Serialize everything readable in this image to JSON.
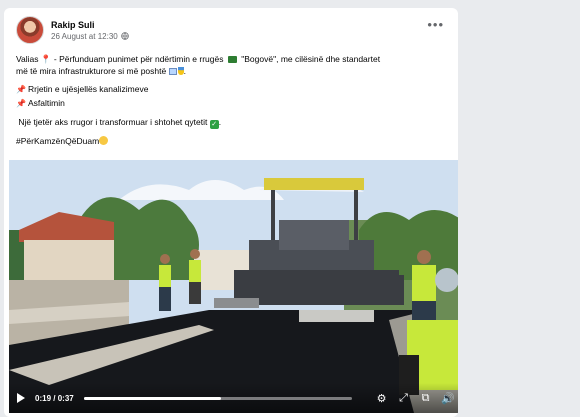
{
  "post": {
    "author": "Rakip Suli",
    "timestamp": "26 August at 12:30",
    "privacy_icon": "globe-icon",
    "more_icon": "more-options-icon",
    "more_glyph": "•••",
    "line1_prefix": "Valias",
    "line1_text": "- Përfunduam punimet për ndërtimin e rrugës",
    "line1_quote": "\"Bogovë\", me cilësinë dhe standartet",
    "line2_text": "më të mira infrastrukturore si më poshtë",
    "bullet1": "Rrjetin e ujësjellës kanalizimeve",
    "bullet2": "Asfaltimin",
    "line3_text": "Një tjetër aks rrugor i transformuar i shtohet qytetit",
    "hashtag": "#PërKamzënQëDuam",
    "check_glyph": "✓"
  },
  "video": {
    "current_time": "0:19",
    "separator": "/",
    "duration": "0:37",
    "progress_fraction": 0.51,
    "settings_glyph": "⚙",
    "fullscreen_glyph": "⤢",
    "pip_glyph": "⧉",
    "volume_glyph": "🔊"
  },
  "footer": {
    "text": ""
  },
  "colors": {
    "asphalt": "#16181c",
    "machine": "#4a4e55",
    "vest": "#c7e83a",
    "sky": "#cfdff0"
  }
}
